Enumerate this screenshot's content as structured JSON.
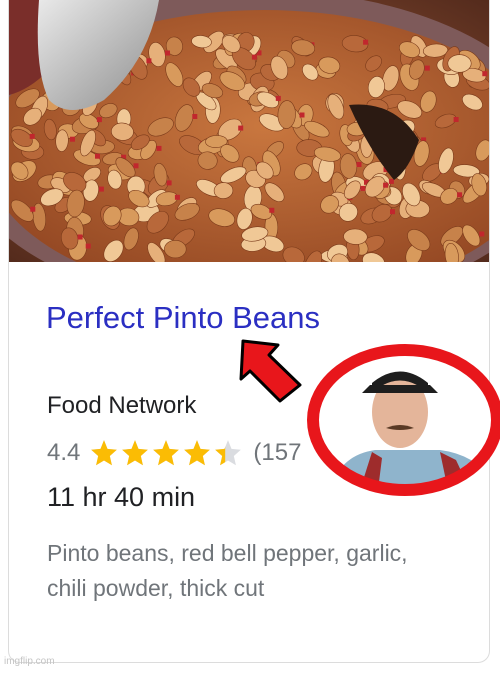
{
  "recipe": {
    "title": "Perfect Pinto Beans",
    "source": "Food Network",
    "rating": "4.4",
    "rating_value": 4.4,
    "rating_max": 5,
    "review_count": "(157",
    "time": "11 hr 40 min",
    "ingredients": "Pinto beans, red bell pepper, garlic, chili powder, thick cut"
  },
  "colors": {
    "title_link": "#2b2fc2",
    "star": "#fbbc04",
    "annotation_red": "#e8161b"
  },
  "icons": [
    "star-icon",
    "red-arrow",
    "red-circle"
  ],
  "watermark": "imgflip.com"
}
